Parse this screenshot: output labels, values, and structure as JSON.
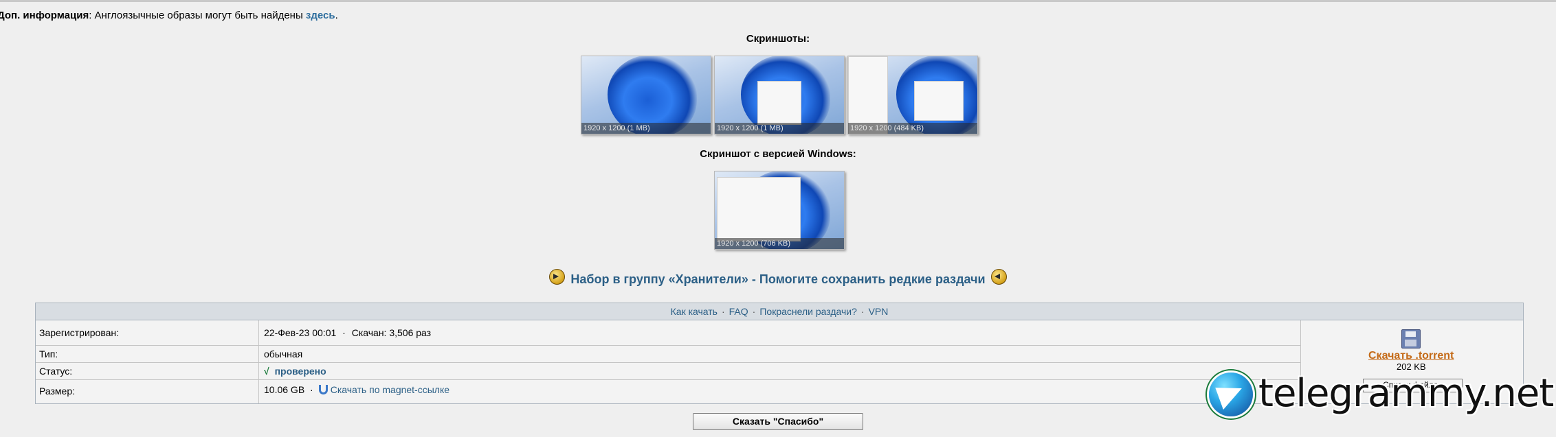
{
  "info": {
    "label": "Доп. информация",
    "text": ": Англоязычные образы могут быть найдены ",
    "link": "здесь",
    "end": "."
  },
  "screenshots": {
    "title": "Скриншоты:",
    "items": [
      {
        "caption": "1920 x 1200 (1 MB)"
      },
      {
        "caption": "1920 x 1200 (1 MB)"
      },
      {
        "caption": "1920 x 1200 (484 KB)"
      }
    ]
  },
  "version_shot": {
    "title": "Скриншот с версией Windows:",
    "caption": "1920 x 1200 (706 KB)"
  },
  "banner": {
    "text": "Набор в группу «Хранители» - Помогите сохранить редкие раздачи"
  },
  "links": [
    "Как качать",
    "FAQ",
    "Покраснели раздачи?",
    "VPN"
  ],
  "details": {
    "registered_label": "Зарегистрирован:",
    "registered_value": "22-Фев-23 00:01",
    "downloaded": "Скачан: 3,506 раз",
    "type_label": "Тип:",
    "type_value": "обычная",
    "status_label": "Статус:",
    "status_mark": "√",
    "status_value": "проверено",
    "size_label": "Размер:",
    "size_value": "10.06 GB",
    "magnet_text": "Скачать по magnet-ссылке"
  },
  "download": {
    "link": "Скачать .torrent",
    "size": "202 KB",
    "filelist_button": "Список файлов"
  },
  "thanks_button": "Сказать \"Спасибо\"",
  "watermark": "telegrammy.net",
  "colors": {
    "link": "#2b5f86",
    "download": "#c46a17",
    "background": "#efefef"
  }
}
